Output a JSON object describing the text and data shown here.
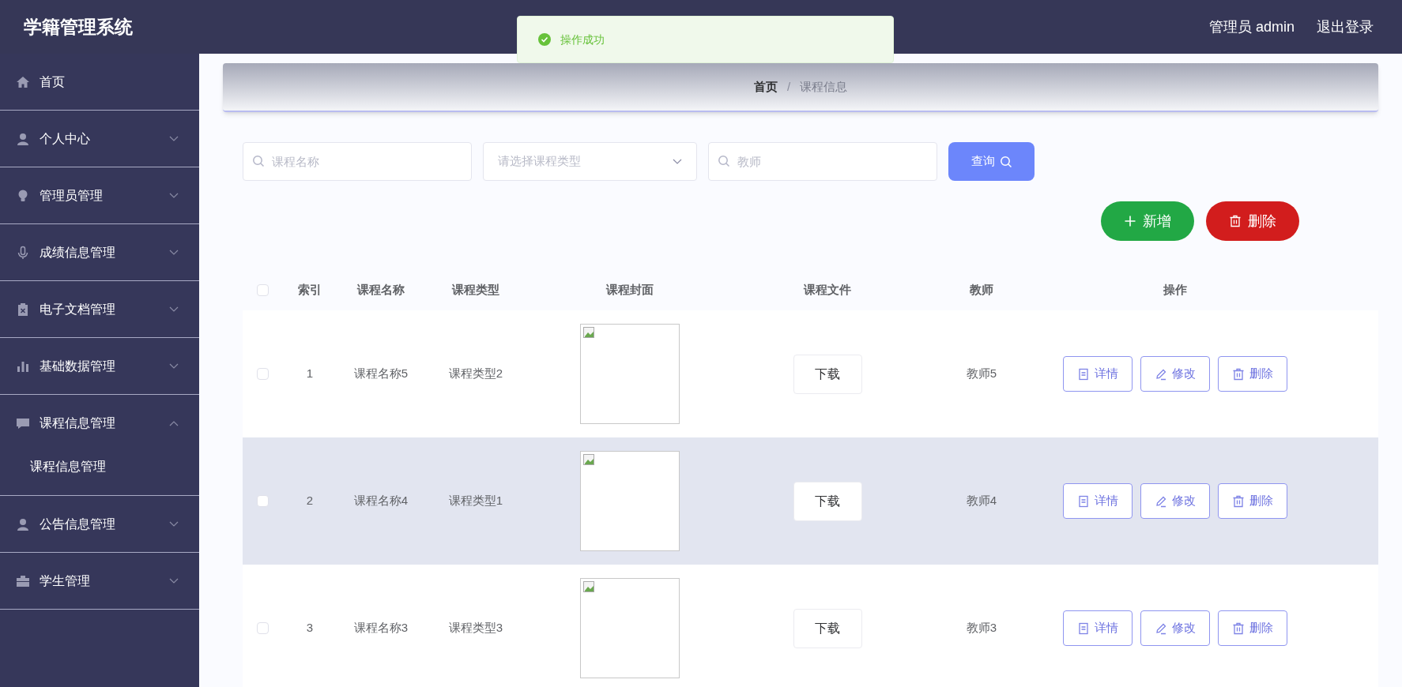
{
  "app_title": "学籍管理系统",
  "user": {
    "label": "管理员 admin",
    "logout": "退出登录"
  },
  "toast": {
    "kind": "success",
    "text": "操作成功"
  },
  "sidebar": {
    "items": [
      {
        "label": "首页"
      },
      {
        "label": "个人中心",
        "expanded": false
      },
      {
        "label": "管理员管理",
        "expanded": false
      },
      {
        "label": "成绩信息管理",
        "expanded": false
      },
      {
        "label": "电子文档管理",
        "expanded": false
      },
      {
        "label": "基础数据管理",
        "expanded": false
      },
      {
        "label": "课程信息管理",
        "expanded": true,
        "children": [
          {
            "label": "课程信息管理"
          }
        ]
      },
      {
        "label": "公告信息管理",
        "expanded": false
      },
      {
        "label": "学生管理",
        "expanded": false
      }
    ]
  },
  "breadcrumb": [
    {
      "label": "首页",
      "current": false
    },
    {
      "label": "课程信息",
      "current": true
    }
  ],
  "breadcrumb_separator": "/",
  "filters": [
    {
      "kind": "search",
      "placeholder": "课程名称"
    },
    {
      "kind": "select",
      "placeholder": "请选择课程类型"
    },
    {
      "kind": "search",
      "placeholder": "教师"
    }
  ],
  "query_button": "查询",
  "actions": [
    {
      "kind": "add",
      "label": "新增"
    },
    {
      "kind": "delete",
      "label": "删除"
    }
  ],
  "table": {
    "all_checked": false,
    "columns": [
      "索引",
      "课程名称",
      "课程类型",
      "课程封面",
      "课程文件",
      "教师",
      "操作"
    ],
    "rows": [
      {
        "index": "1",
        "name": "课程名称5",
        "type": "课程类型2",
        "file": "下载",
        "teacher": "教师5",
        "hovered": false,
        "checked": false,
        "buttons": [
          {
            "kind": "detail",
            "label": "详情"
          },
          {
            "kind": "edit",
            "label": "修改"
          },
          {
            "kind": "delete",
            "label": "删除"
          }
        ]
      },
      {
        "index": "2",
        "name": "课程名称4",
        "type": "课程类型1",
        "file": "下载",
        "teacher": "教师4",
        "hovered": true,
        "checked": false,
        "buttons": [
          {
            "kind": "detail",
            "label": "详情"
          },
          {
            "kind": "edit",
            "label": "修改"
          },
          {
            "kind": "delete",
            "label": "删除"
          }
        ]
      },
      {
        "index": "3",
        "name": "课程名称3",
        "type": "课程类型3",
        "file": "下载",
        "teacher": "教师3",
        "hovered": false,
        "checked": false,
        "buttons": [
          {
            "kind": "detail",
            "label": "详情"
          },
          {
            "kind": "edit",
            "label": "修改"
          },
          {
            "kind": "delete",
            "label": "删除"
          }
        ]
      }
    ]
  }
}
